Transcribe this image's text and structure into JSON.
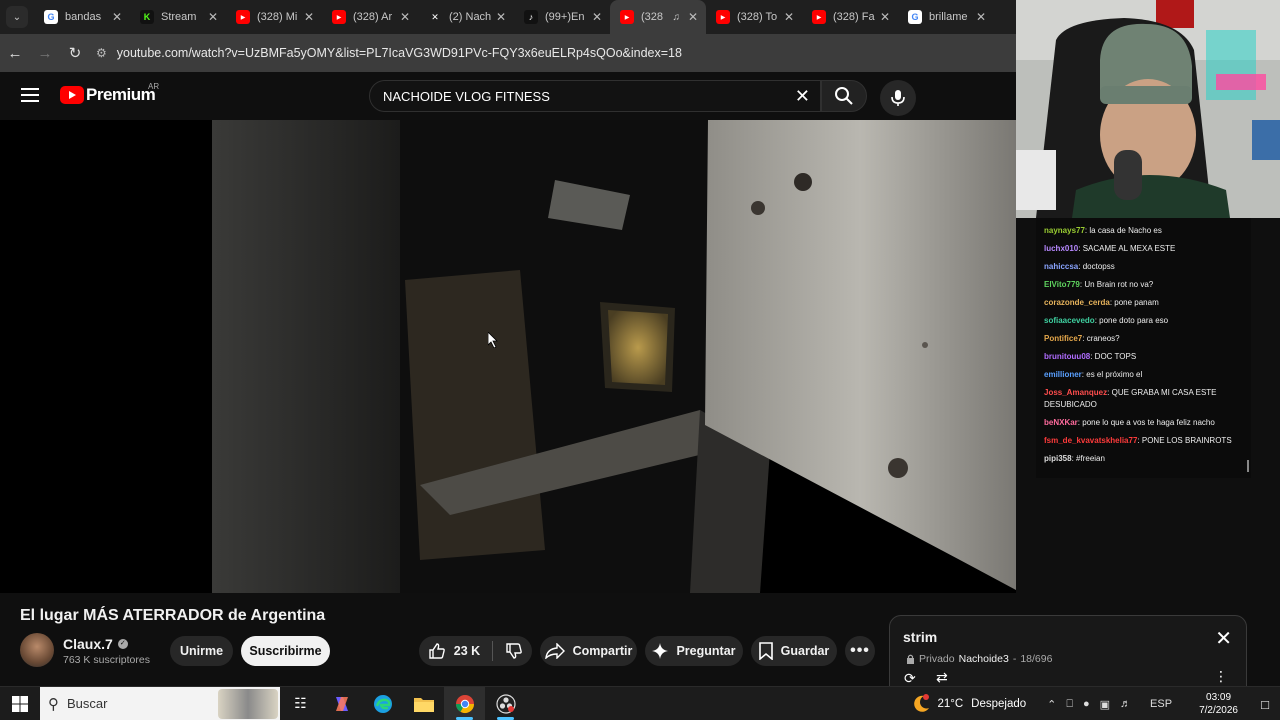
{
  "browser": {
    "tabs": [
      {
        "label": "bandas",
        "icon": "google-icon"
      },
      {
        "label": "Stream",
        "icon": "kick-icon"
      },
      {
        "label": "(328) Mi",
        "icon": "youtube-icon"
      },
      {
        "label": "(328) Ar",
        "icon": "youtube-icon"
      },
      {
        "label": "(2) Nach",
        "icon": "x-icon"
      },
      {
        "label": "(99+)En",
        "icon": "tiktok-icon"
      },
      {
        "label": "(328",
        "icon": "youtube-icon",
        "active": true
      },
      {
        "label": "(328) To",
        "icon": "youtube-icon"
      },
      {
        "label": "(328) Fa",
        "icon": "youtube-icon"
      },
      {
        "label": "brillame",
        "icon": "google-icon"
      }
    ],
    "url": "youtube.com/watch?v=UzBMFa5yOMY&list=PL7IcaVG3WD91PVc-FQY3x6euELRp4sQOo&index=18"
  },
  "youtube": {
    "logo_text": "Premium",
    "region": "AR",
    "search_query": "NACHOIDE VLOG FITNESS"
  },
  "chat": {
    "messages": [
      {
        "user": "naynays77",
        "text": "la casa de Nacho es",
        "color": "#9acd32"
      },
      {
        "user": "luchx010",
        "text": "SACAME AL MEXA ESTE",
        "color": "#b788ff"
      },
      {
        "user": "nahiccsa",
        "text": "doctopss",
        "color": "#8aa4ff"
      },
      {
        "user": "ElVito779",
        "text": "Un Brain rot no va?",
        "color": "#5fd35f"
      },
      {
        "user": "corazonde_cerda",
        "text": "pone panam",
        "color": "#e6b35c"
      },
      {
        "user": "sofiaacevedo",
        "text": "pone doto para eso",
        "color": "#3fd0a0"
      },
      {
        "user": "Pontifice7",
        "text": "craneos?",
        "color": "#e6a84b"
      },
      {
        "user": "brunitouu08",
        "text": "DOC TOPS",
        "color": "#b06cff"
      },
      {
        "user": "emillioner",
        "text": "es el próximo el",
        "color": "#5aa0ff"
      },
      {
        "user": "Joss_Amanquez",
        "text": "QUE GRABA MI CASA ESTE DESUBICADO",
        "color": "#ff4d4d"
      },
      {
        "user": "beNXKar",
        "text": "pone lo que a vos te haga feliz nacho",
        "color": "#ff6b9d"
      },
      {
        "user": "fsm_de_kvavatskhelia77",
        "text": "PONE LOS BRAINROTS",
        "color": "#ff3b3b"
      },
      {
        "user": "pipi358",
        "text": "#freeian",
        "color": "#dddddd"
      }
    ]
  },
  "video": {
    "title": "El lugar MÁS ATERRADOR de Argentina",
    "channel": "Claux.7",
    "subscribers": "763 K suscriptores",
    "join_label": "Unirme",
    "subscribe_label": "Suscribirme",
    "likes": "23 K",
    "share_label": "Compartir",
    "ask_label": "Preguntar",
    "save_label": "Guardar"
  },
  "playlist": {
    "title": "strim",
    "privacy": "Privado",
    "owner": "Nachoide3",
    "position": "18/696"
  },
  "taskbar": {
    "search_placeholder": "Buscar",
    "temperature": "21°C",
    "weather": "Despejado",
    "language": "ESP",
    "time": "03:09",
    "date": "7/2/2026"
  }
}
